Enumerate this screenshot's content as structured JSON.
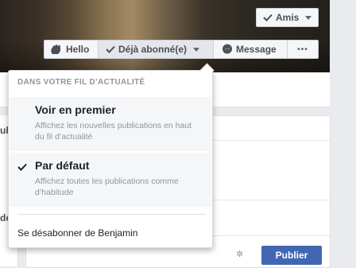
{
  "cover": {
    "alt": "cover photo"
  },
  "buttons": {
    "friends": "Amis",
    "hello": "Hello",
    "following": "Déjà abonné(e)",
    "message": "Message",
    "more": "•••"
  },
  "dropdown": {
    "header": "DANS VOTRE FIL D’ACTUALITÉ",
    "options": [
      {
        "title": "Voir en premier",
        "description": "Affichez les nouvelles publications en haut du fil d’actualité",
        "checked": false
      },
      {
        "title": "Par défaut",
        "description": "Affichez toutes les publications comme d’habitude",
        "checked": true
      }
    ],
    "unsubscribe": "Se désabonner de Benjamin"
  },
  "background": {
    "partial_label_1": "ub",
    "partial_label_2": "dé",
    "publish": "Publier"
  },
  "colors": {
    "primary": "#4267b2",
    "page_bg": "#e9ebee",
    "muted_text": "#90949c"
  }
}
